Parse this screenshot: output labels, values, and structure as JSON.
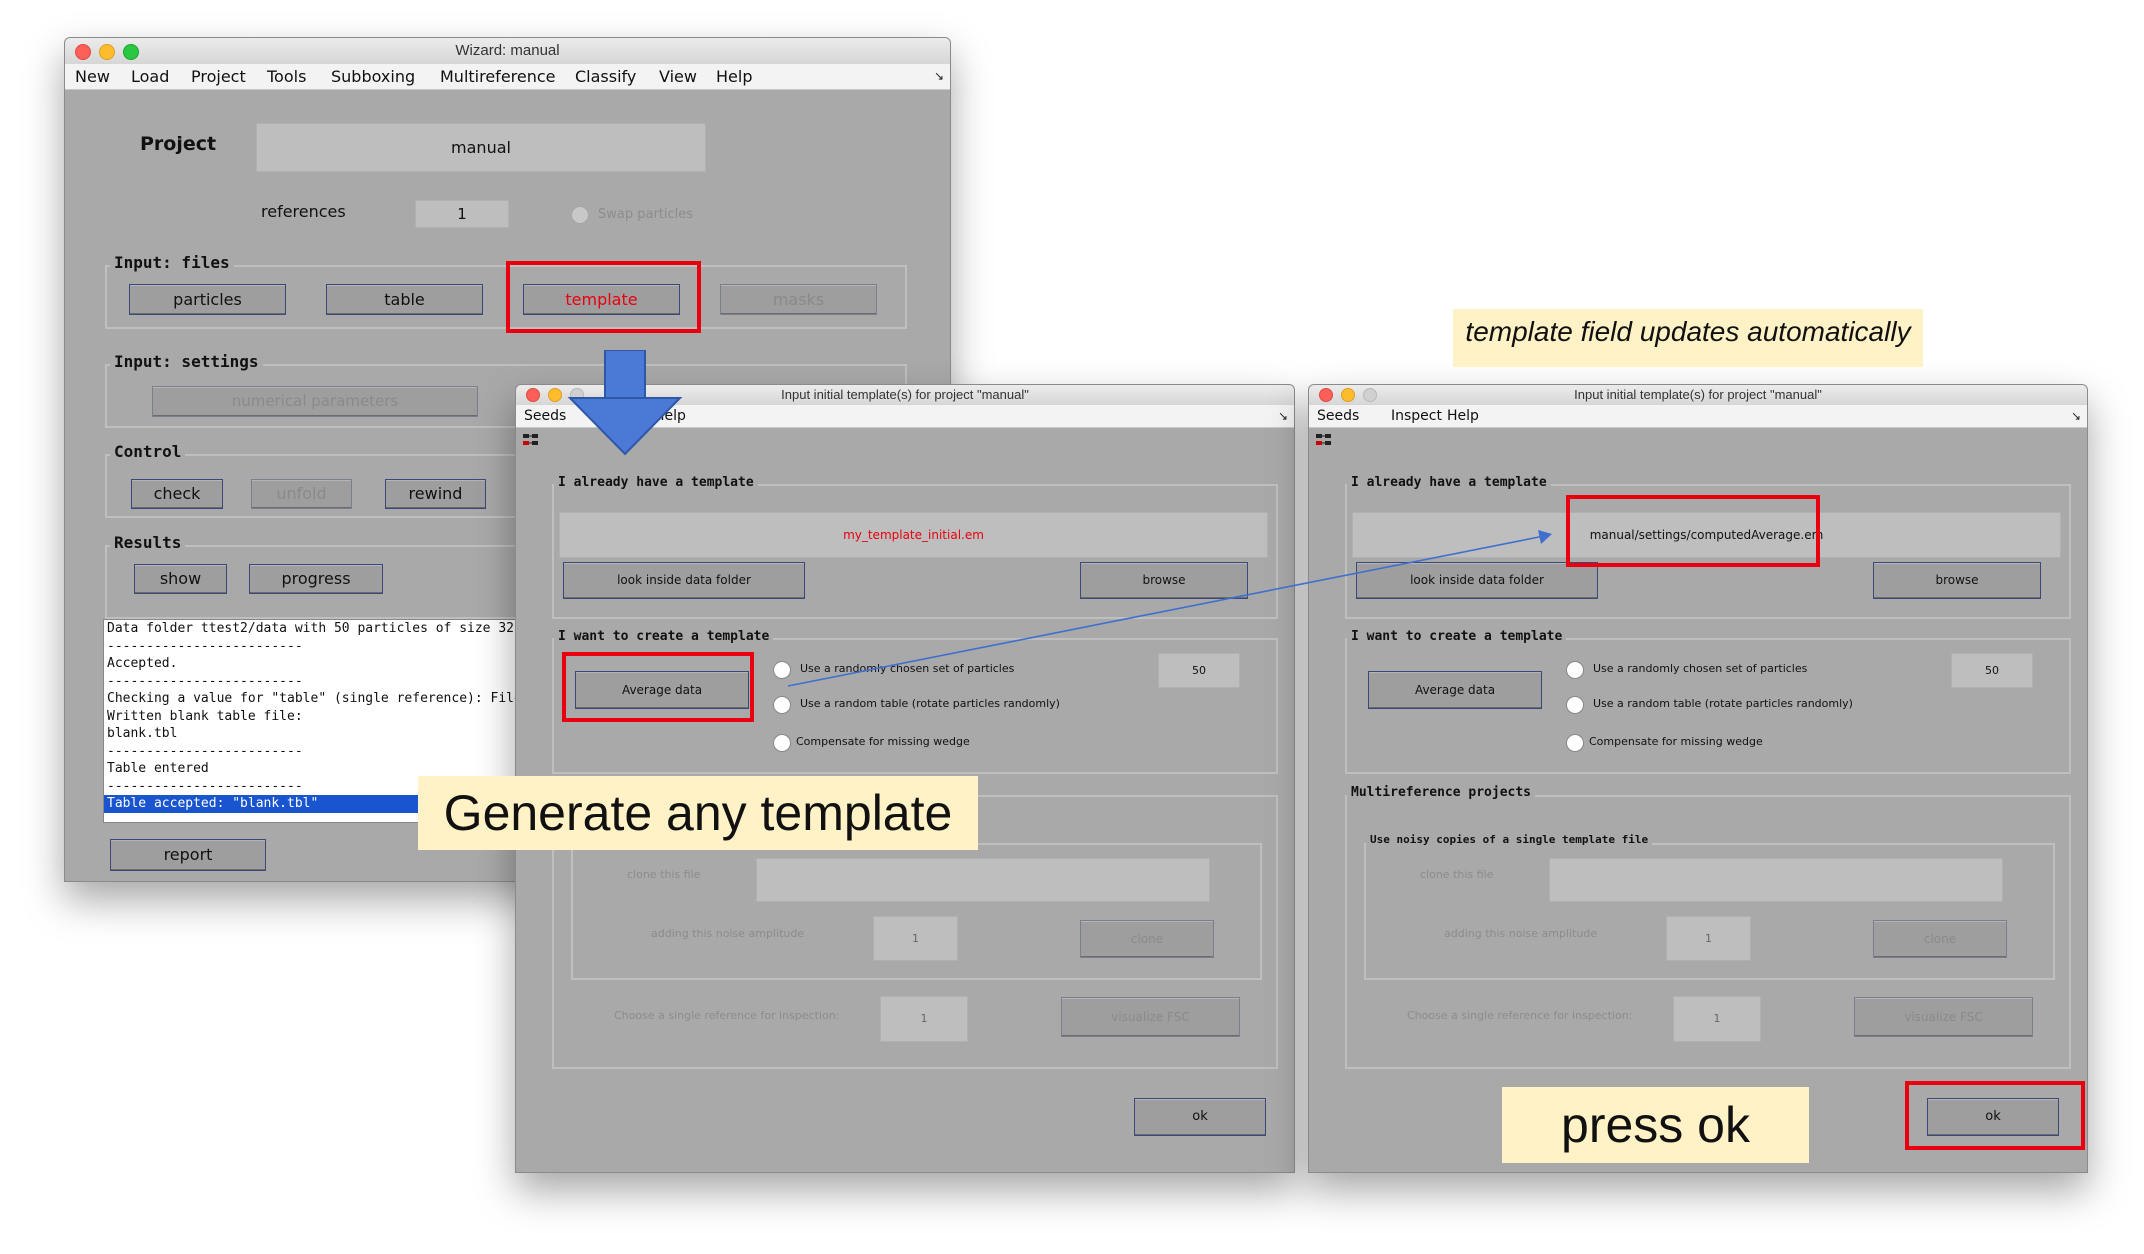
{
  "main_window": {
    "title": "Wizard: manual",
    "menu": [
      "New",
      "Load",
      "Project",
      "Tools",
      "Subboxing",
      "Multireference",
      "Classify",
      "View",
      "Help"
    ],
    "project_label": "Project",
    "project_name": "manual",
    "references_label": "references",
    "references_value": "1",
    "swap_particles_label": "Swap particles",
    "input_files": {
      "title": "Input: files",
      "buttons": [
        "particles",
        "table",
        "template",
        "masks"
      ]
    },
    "input_settings": {
      "title": "Input: settings",
      "numerical_parameters": "numerical parameters"
    },
    "control": {
      "title": "Control",
      "buttons": [
        "check",
        "unfold",
        "rewind"
      ]
    },
    "results": {
      "title": "Results",
      "buttons": [
        "show",
        "progress"
      ]
    },
    "log_lines": [
      "Data folder ttest2/data with 50 particles of size 32",
      "-------------------------",
      "Accepted.",
      "-------------------------",
      "Checking a value for \"table\" (single reference): File does not exist",
      "Written blank table file:",
      "blank.tbl",
      "-------------------------",
      "Table entered",
      "-------------------------",
      "Table accepted: \"blank.tbl\""
    ],
    "report_button": "report"
  },
  "dialog_left": {
    "title": "Input initial template(s) for project \"manual\"",
    "menu": [
      "Seeds",
      "Help"
    ],
    "have_template": {
      "title": "I already have a template",
      "file": "my_template_initial.em",
      "look_inside": "look inside data folder",
      "browse": "browse"
    },
    "create_template": {
      "title": "I want to create a template",
      "average_button": "Average data",
      "random_set": "Use a randomly chosen set of particles",
      "random_set_count": "50",
      "random_table": "Use a random table (rotate particles randomly)",
      "missing_wedge": "Compensate for missing wedge"
    },
    "multireference": {
      "clone_file": "clone this file",
      "noise_amplitude": "adding this noise amplitude",
      "noise_value": "1",
      "clone_button": "clone",
      "choose_reference": "Choose a single reference for inspection:",
      "reference_value": "1",
      "visualize_fsc": "visualize FSC"
    },
    "ok": "ok"
  },
  "dialog_right": {
    "title": "Input initial template(s) for project \"manual\"",
    "menu": [
      "Seeds",
      "Inspect",
      "Help"
    ],
    "have_template": {
      "title": "I already have a template",
      "file": "manual/settings/computedAverage.em",
      "look_inside": "look inside data folder",
      "browse": "browse"
    },
    "create_template": {
      "title": "I want to create a template",
      "average_button": "Average data",
      "random_set": "Use a randomly chosen set of particles",
      "random_set_count": "50",
      "random_table": "Use a random table (rotate particles randomly)",
      "missing_wedge": "Compensate for missing wedge"
    },
    "multireference": {
      "title": "Multireference projects",
      "subtitle": "Use noisy copies of a single template file",
      "clone_file": "clone this file",
      "noise_amplitude": "adding this noise amplitude",
      "noise_value": "1",
      "clone_button": "clone",
      "choose_reference": "Choose a single reference for inspection:",
      "reference_value": "1",
      "visualize_fsc": "visualize FSC"
    },
    "ok": "ok"
  },
  "callouts": {
    "generate": "Generate any template",
    "updates": "template field updates automatically",
    "press_ok": "press ok"
  },
  "colors": {
    "highlight": "#e8000f",
    "arrow": "#3f6fcf",
    "callout_bg": "#fff2c6",
    "selection": "#1a55d0"
  }
}
